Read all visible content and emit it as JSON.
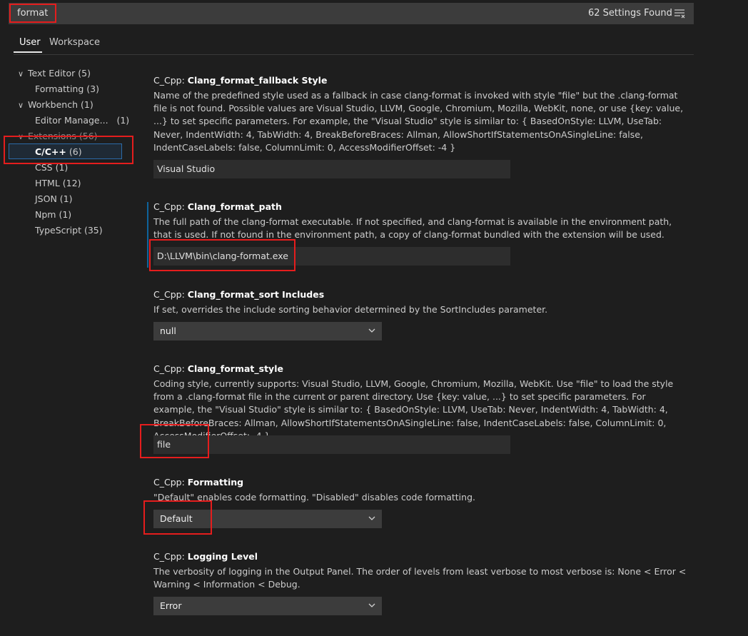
{
  "search": {
    "value": "format",
    "count": "62 Settings Found"
  },
  "tabs": [
    {
      "label": "User"
    },
    {
      "label": "Workspace"
    }
  ],
  "tree": [
    {
      "label": "Text Editor",
      "count": "(5)",
      "expanded": true
    },
    {
      "label": "Formatting",
      "count": "(3)"
    },
    {
      "label": "Workbench",
      "count": "(1)",
      "expanded": true
    },
    {
      "label": "Editor Manage...",
      "count": "(1)"
    },
    {
      "label": "Extensions",
      "count": "(56)",
      "expanded": true
    },
    {
      "label": "C/C++",
      "count": "(6)",
      "selected": true
    },
    {
      "label": "CSS",
      "count": "(1)"
    },
    {
      "label": "HTML",
      "count": "(12)"
    },
    {
      "label": "JSON",
      "count": "(1)"
    },
    {
      "label": "Npm",
      "count": "(1)"
    },
    {
      "label": "TypeScript",
      "count": "(35)"
    }
  ],
  "settings": [
    {
      "category": "C_Cpp: ",
      "name": "Clang_format_fallback Style",
      "description": "Name of the predefined style used as a fallback in case clang-format is invoked with style \"file\" but the .clang-format file is not found. Possible values are Visual Studio, LLVM, Google, Chromium, Mozilla, WebKit, none, or use {key: value, ...} to set specific parameters. For example, the \"Visual Studio\" style is similar to: { BasedOnStyle: LLVM, UseTab: Never, IndentWidth: 4, TabWidth: 4, BreakBeforeBraces: Allman, AllowShortIfStatementsOnASingleLine: false, IndentCaseLabels: false, ColumnLimit: 0, AccessModifierOffset: -4 }",
      "value": "Visual Studio"
    },
    {
      "category": "C_Cpp: ",
      "name": "Clang_format_path",
      "description": "The full path of the clang-format executable. If not specified, and clang-format is available in the environment path, that is used. If not found in the environment path, a copy of clang-format bundled with the extension will be used.",
      "value": "D:\\LLVM\\bin\\clang-format.exe"
    },
    {
      "category": "C_Cpp: ",
      "name": "Clang_format_sort Includes",
      "description": "If set, overrides the include sorting behavior determined by the SortIncludes parameter.",
      "value": "null"
    },
    {
      "category": "C_Cpp: ",
      "name": "Clang_format_style",
      "description": "Coding style, currently supports: Visual Studio, LLVM, Google, Chromium, Mozilla, WebKit. Use \"file\" to load the style from a .clang-format file in the current or parent directory. Use {key: value, ...} to set specific parameters. For example, the \"Visual Studio\" style is similar to: { BasedOnStyle: LLVM, UseTab: Never, IndentWidth: 4, TabWidth: 4, BreakBeforeBraces: Allman, AllowShortIfStatementsOnASingleLine: false, IndentCaseLabels: false, ColumnLimit: 0, AccessModifierOffset: -4 }",
      "value": "file"
    },
    {
      "category": "C_Cpp: ",
      "name": "Formatting",
      "description": "\"Default\" enables code formatting. \"Disabled\" disables code formatting.",
      "value": "Default"
    },
    {
      "category": "C_Cpp: ",
      "name": "Logging Level",
      "description": "The verbosity of logging in the Output Panel. The order of levels from least verbose to most verbose is: None < Error < Warning < Information < Debug.",
      "value": "Error"
    }
  ],
  "colors": {
    "highlight_box": "#e51d1d",
    "modified_indicator": "#0e639c",
    "background": "#1e1e1e"
  },
  "icons": {
    "filter": "clear-filter-icon",
    "chevron": "chevron-down-icon"
  }
}
